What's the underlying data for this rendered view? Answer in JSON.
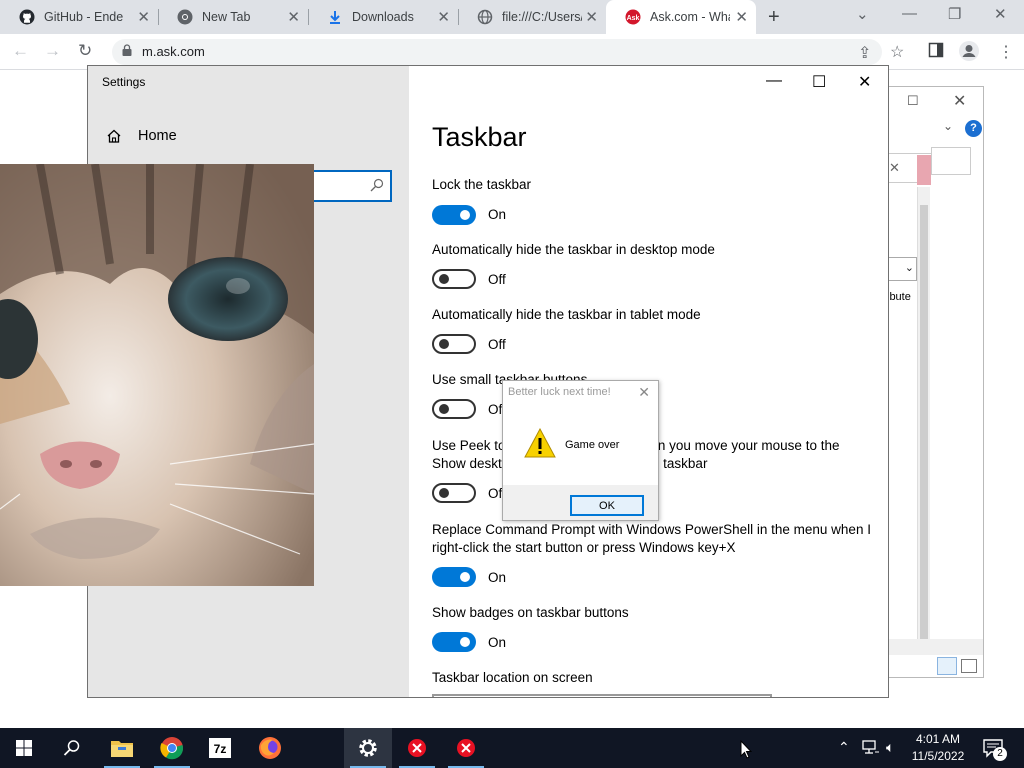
{
  "browser": {
    "tabs": [
      {
        "label": "GitHub - Endem",
        "icon": "github-icon"
      },
      {
        "label": "New Tab",
        "icon": "chrome-icon"
      },
      {
        "label": "Downloads",
        "icon": "download-icon"
      },
      {
        "label": "file:///C:/Users/",
        "icon": "globe-icon"
      },
      {
        "label": "Ask.com - What",
        "icon": "ask-icon"
      }
    ],
    "new_tab": "+",
    "url": "m.ask.com"
  },
  "settings": {
    "window_title": "Settings",
    "home_label": "Home",
    "page_title": "Taskbar",
    "items": [
      {
        "label": "Lock the taskbar",
        "state": "On"
      },
      {
        "label": "Automatically hide the taskbar in desktop mode",
        "state": "Off"
      },
      {
        "label": "Automatically hide the taskbar in tablet mode",
        "state": "Off"
      },
      {
        "label": "Use small taskbar buttons",
        "state": "Off"
      },
      {
        "label": "Use Peek to preview the desktop when you move your mouse to the Show desktop button at the end of the taskbar",
        "state": "Off"
      },
      {
        "label": "Replace Command Prompt with Windows PowerShell in the menu when I right-click the start button or press Windows key+X",
        "state": "On"
      },
      {
        "label": "Show badges on taskbar buttons",
        "state": "On"
      }
    ],
    "location_label": "Taskbar location on screen"
  },
  "dialog": {
    "title": "Better luck next time!",
    "message": "Game over",
    "ok_label": "OK"
  },
  "background_window": {
    "partial_text": "ibute"
  },
  "taskbar": {
    "time": "4:01 AM",
    "date": "11/5/2022",
    "notification_count": "2",
    "apps": [
      "windows-start",
      "search",
      "file-explorer",
      "chrome",
      "7zip",
      "firefox",
      "settings",
      "error-app",
      "error-app"
    ]
  },
  "colors": {
    "accent": "#0078d7",
    "taskbar": "#101624",
    "settings_nav": "#e6e6e6"
  }
}
